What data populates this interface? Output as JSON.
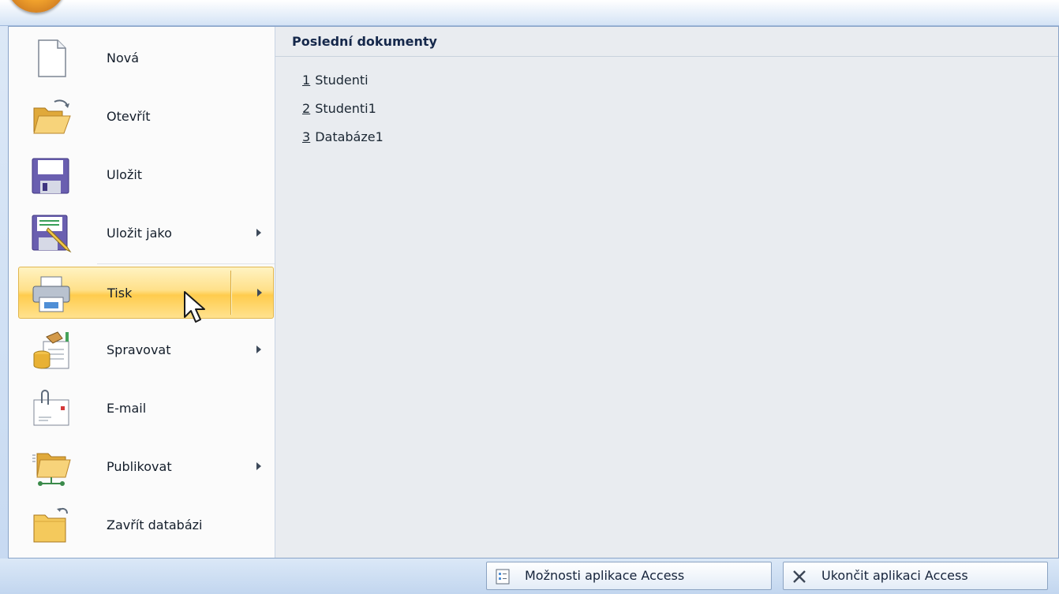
{
  "recent": {
    "title": "Poslední dokumenty",
    "items": [
      {
        "key": "1",
        "label": "Studenti"
      },
      {
        "key": "2",
        "label": "Studenti1"
      },
      {
        "key": "3",
        "label": "Databáze1"
      }
    ]
  },
  "commands": [
    {
      "label": "Nová",
      "icon": "new-document-icon",
      "submenu": false
    },
    {
      "label": "Otevřít",
      "icon": "open-folder-icon",
      "submenu": false
    },
    {
      "label": "Uložit",
      "icon": "save-icon",
      "submenu": false
    },
    {
      "label": "Uložit jako",
      "icon": "save-as-icon",
      "submenu": true
    },
    {
      "label": "Tisk",
      "icon": "printer-icon",
      "submenu": true,
      "highlighted": true
    },
    {
      "label": "Spravovat",
      "icon": "manage-icon",
      "submenu": true
    },
    {
      "label": "E-mail",
      "icon": "email-icon",
      "submenu": false
    },
    {
      "label": "Publikovat",
      "icon": "publish-icon",
      "submenu": true
    },
    {
      "label": "Zavřít databázi",
      "icon": "close-database-icon",
      "submenu": false
    }
  ],
  "footer": {
    "options_label": "Možnosti aplikace Access",
    "exit_label": "Ukončit aplikaci Access"
  },
  "colors": {
    "highlight": "#ffd35c",
    "panel_bg": "#e9ecf0",
    "frame_blue": "#c6d9f1"
  }
}
